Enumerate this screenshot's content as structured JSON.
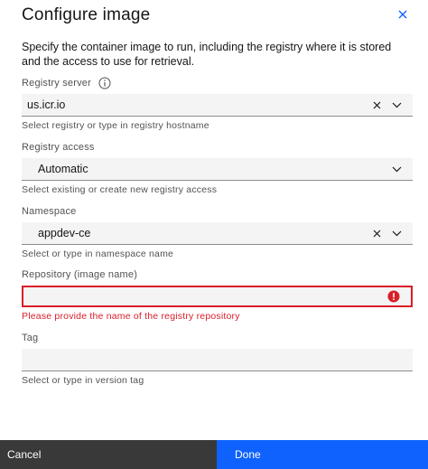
{
  "dialog": {
    "title": "Configure image",
    "description": "Specify the container image to run, including the registry where it is stored and the access to use for retrieval."
  },
  "fields": {
    "registry_server": {
      "label": "Registry server",
      "value": "us.icr.io",
      "helper": "Select registry or type in registry hostname"
    },
    "registry_access": {
      "label": "Registry access",
      "value": "Automatic",
      "helper": "Select existing or create new registry access"
    },
    "namespace": {
      "label": "Namespace",
      "value": "appdev-ce",
      "helper": "Select or type in namespace name"
    },
    "repository": {
      "label": "Repository (image name)",
      "value": "",
      "error": "Please provide the name of the registry repository"
    },
    "tag": {
      "label": "Tag",
      "value": "",
      "helper": "Select or type in version tag"
    }
  },
  "footer": {
    "cancel_label": "Cancel",
    "done_label": "Done"
  },
  "colors": {
    "primary": "#0f62fe",
    "error": "#da1e28",
    "secondary_button": "#393939",
    "field_background": "#f4f4f4"
  },
  "icons": {
    "close": "close-icon",
    "info": "info-icon",
    "clear": "clear-icon",
    "chevron": "chevron-down-icon",
    "error": "error-icon"
  }
}
